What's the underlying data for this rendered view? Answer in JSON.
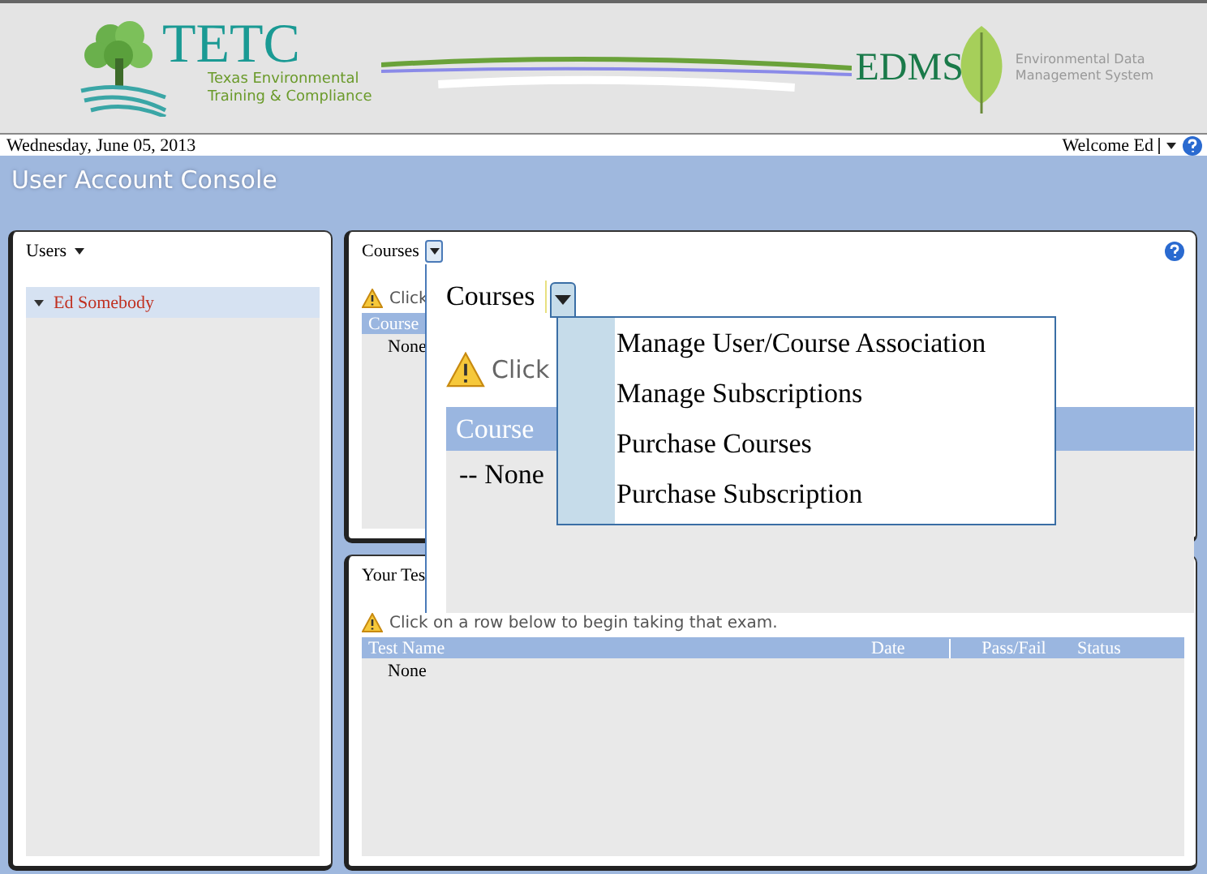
{
  "header": {
    "logo_left": {
      "name": "TETC",
      "subtitle_lines": [
        "Texas Environmental",
        "Training & Compliance"
      ]
    },
    "logo_right": {
      "name": "EDMS",
      "subtitle_lines": [
        "Environmental Data",
        "Management System"
      ]
    }
  },
  "date_bar": {
    "date": "Wednesday, June 05, 2013",
    "welcome": "Welcome Ed"
  },
  "page_title": "User Account Console",
  "users_panel": {
    "title": "Users",
    "tree": [
      {
        "label": "Ed Somebody",
        "selected": true,
        "expanded": true
      }
    ]
  },
  "courses_panel": {
    "title": "Courses",
    "notice": "Click",
    "table": {
      "columns": [
        "Course"
      ],
      "rows": [
        "None"
      ]
    }
  },
  "tests_panel": {
    "title": "Your Tes",
    "notice": "Click on a row below to begin taking that exam.",
    "table": {
      "columns": [
        "Test Name",
        "Date",
        "Pass/Fail",
        "Status"
      ],
      "rows": [
        "None"
      ]
    }
  },
  "magnified_view": {
    "title": "Courses",
    "notice": "Click",
    "table": {
      "columns": [
        "Course"
      ],
      "rows": [
        "-- None"
      ]
    },
    "menu": {
      "items": [
        "Manage User/Course Association",
        "Manage Subscriptions",
        "Purchase Courses",
        "Purchase Subscription"
      ]
    }
  }
}
